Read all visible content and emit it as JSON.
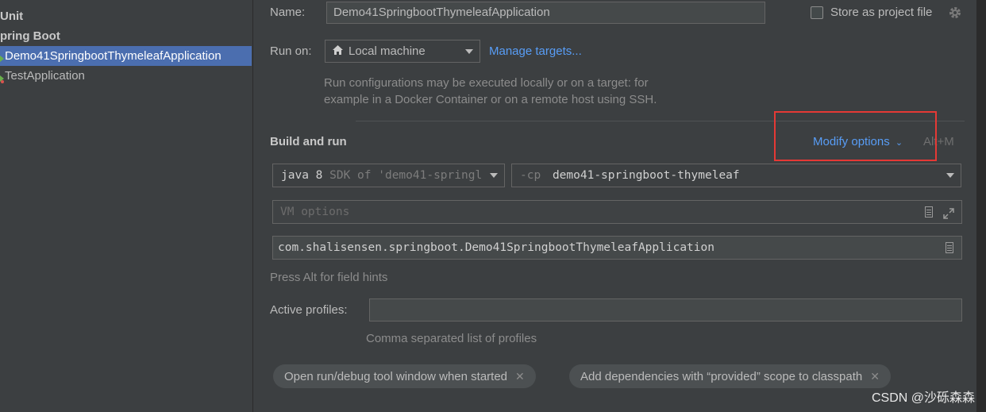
{
  "sidebar": {
    "items": [
      {
        "label": "Unit",
        "bold": true
      },
      {
        "label": "pring Boot",
        "bold": true
      },
      {
        "label": "Demo41SpringbootThymeleafApplication",
        "selected": true
      },
      {
        "label": "TestApplication"
      }
    ]
  },
  "form": {
    "name_label": "Name:",
    "name_value": "Demo41SpringbootThymeleafApplication",
    "store_label": "Store as project file",
    "run_on_label": "Run on:",
    "run_on_value": "Local machine",
    "manage_targets": "Manage targets...",
    "run_hint_line1": "Run configurations may be executed locally or on a target: for",
    "run_hint_line2": "example in a Docker Container or on a remote host using SSH.",
    "build_section": "Build and run",
    "modify_options": "Modify options",
    "modify_shortcut": "Alt+M",
    "jdk_main": "java 8",
    "jdk_suffix": "SDK of 'demo41-springl",
    "cp_prefix": "-cp",
    "cp_value": "demo41-springboot-thymeleaf",
    "vm_placeholder": "VM options",
    "main_class": "com.shalisensen.springboot.Demo41SpringbootThymeleafApplication",
    "field_hints": "Press Alt for field hints",
    "profiles_label": "Active profiles:",
    "profiles_value": "",
    "profiles_hint": "Comma separated list of profiles",
    "chips": [
      {
        "label": "Open run/debug tool window when started"
      },
      {
        "label": "Add dependencies with “provided” scope to classpath"
      }
    ]
  },
  "watermark": "CSDN @沙砾森森",
  "colors": {
    "accent": "#589df6",
    "selection": "#4b6eaf",
    "highlight": "#e53935"
  }
}
